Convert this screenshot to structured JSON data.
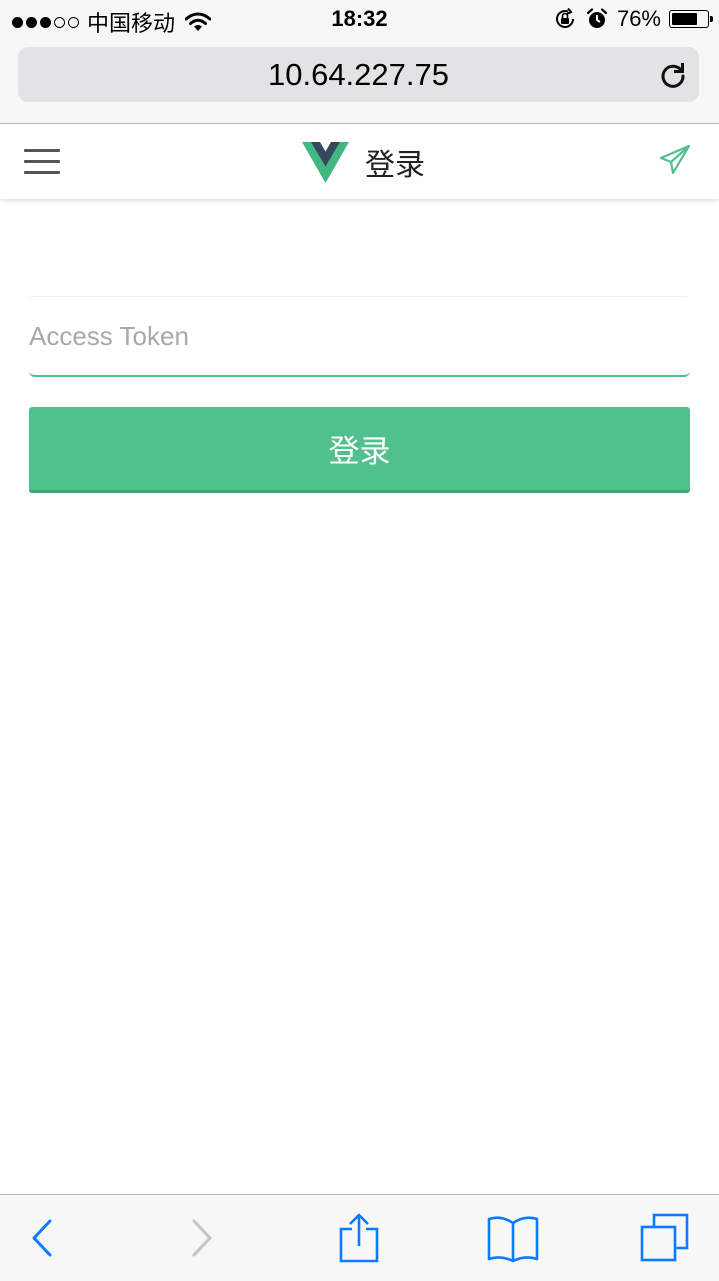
{
  "status_bar": {
    "carrier": "中国移动",
    "time": "18:32",
    "battery": "76%",
    "battery_level": 0.76
  },
  "browser": {
    "url": "10.64.227.75"
  },
  "header": {
    "title": "登录"
  },
  "form": {
    "token_placeholder": "Access Token",
    "token_value": "",
    "submit_label": "登录"
  },
  "colors": {
    "accent": "#4fc08d",
    "vue_dark": "#35495e",
    "ios_blue": "#0a7aff"
  },
  "icons": [
    "menu-icon",
    "vue-logo",
    "send-icon",
    "reload-icon",
    "back-icon",
    "forward-icon",
    "share-icon",
    "bookmarks-icon",
    "tabs-icon"
  ]
}
